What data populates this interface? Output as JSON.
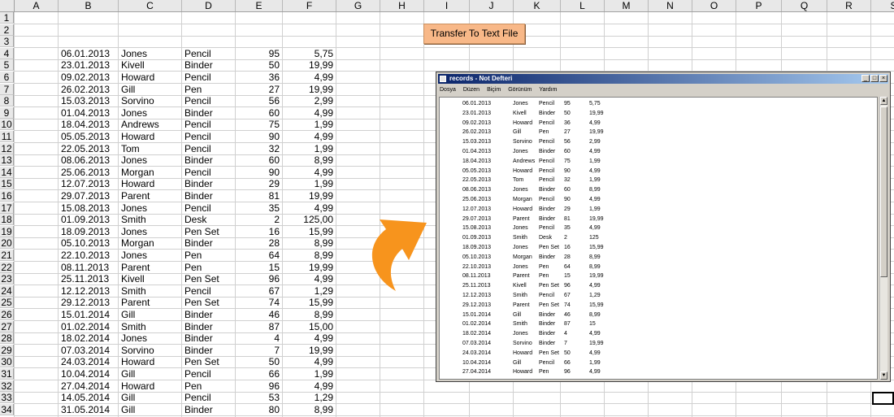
{
  "columns": [
    "A",
    "B",
    "C",
    "D",
    "E",
    "F",
    "G",
    "H",
    "I",
    "J",
    "K",
    "L",
    "M",
    "N",
    "O",
    "P",
    "Q",
    "R",
    "S"
  ],
  "row_numbers": [
    "1",
    "2",
    "3",
    "4",
    "5",
    "6",
    "7",
    "8",
    "9",
    "10",
    "11",
    "12",
    "13",
    "14",
    "15",
    "16",
    "17",
    "18",
    "19",
    "20",
    "21",
    "22",
    "23",
    "24",
    "25",
    "26",
    "27",
    "28",
    "29",
    "30",
    "31",
    "32",
    "33",
    "34"
  ],
  "records": [
    [
      "06.01.2013",
      "Jones",
      "Pencil",
      "95",
      "5,75"
    ],
    [
      "23.01.2013",
      "Kivell",
      "Binder",
      "50",
      "19,99"
    ],
    [
      "09.02.2013",
      "Howard",
      "Pencil",
      "36",
      "4,99"
    ],
    [
      "26.02.2013",
      "Gill",
      "Pen",
      "27",
      "19,99"
    ],
    [
      "15.03.2013",
      "Sorvino",
      "Pencil",
      "56",
      "2,99"
    ],
    [
      "01.04.2013",
      "Jones",
      "Binder",
      "60",
      "4,99"
    ],
    [
      "18.04.2013",
      "Andrews",
      "Pencil",
      "75",
      "1,99"
    ],
    [
      "05.05.2013",
      "Howard",
      "Pencil",
      "90",
      "4,99"
    ],
    [
      "22.05.2013",
      "Tom",
      "Pencil",
      "32",
      "1,99"
    ],
    [
      "08.06.2013",
      "Jones",
      "Binder",
      "60",
      "8,99"
    ],
    [
      "25.06.2013",
      "Morgan",
      "Pencil",
      "90",
      "4,99"
    ],
    [
      "12.07.2013",
      "Howard",
      "Binder",
      "29",
      "1,99"
    ],
    [
      "29.07.2013",
      "Parent",
      "Binder",
      "81",
      "19,99"
    ],
    [
      "15.08.2013",
      "Jones",
      "Pencil",
      "35",
      "4,99"
    ],
    [
      "01.09.2013",
      "Smith",
      "Desk",
      "2",
      "125,00"
    ],
    [
      "18.09.2013",
      "Jones",
      "Pen Set",
      "16",
      "15,99"
    ],
    [
      "05.10.2013",
      "Morgan",
      "Binder",
      "28",
      "8,99"
    ],
    [
      "22.10.2013",
      "Jones",
      "Pen",
      "64",
      "8,99"
    ],
    [
      "08.11.2013",
      "Parent",
      "Pen",
      "15",
      "19,99"
    ],
    [
      "25.11.2013",
      "Kivell",
      "Pen Set",
      "96",
      "4,99"
    ],
    [
      "12.12.2013",
      "Smith",
      "Pencil",
      "67",
      "1,29"
    ],
    [
      "29.12.2013",
      "Parent",
      "Pen Set",
      "74",
      "15,99"
    ],
    [
      "15.01.2014",
      "Gill",
      "Binder",
      "46",
      "8,99"
    ],
    [
      "01.02.2014",
      "Smith",
      "Binder",
      "87",
      "15,00"
    ],
    [
      "18.02.2014",
      "Jones",
      "Binder",
      "4",
      "4,99"
    ],
    [
      "07.03.2014",
      "Sorvino",
      "Binder",
      "7",
      "19,99"
    ],
    [
      "24.03.2014",
      "Howard",
      "Pen Set",
      "50",
      "4,99"
    ],
    [
      "10.04.2014",
      "Gill",
      "Pencil",
      "66",
      "1,99"
    ],
    [
      "27.04.2014",
      "Howard",
      "Pen",
      "96",
      "4,99"
    ],
    [
      "14.05.2014",
      "Gill",
      "Pencil",
      "53",
      "1,29"
    ],
    [
      "31.05.2014",
      "Gill",
      "Binder",
      "80",
      "8,99"
    ]
  ],
  "button_label": "Transfer To Text File",
  "notepad": {
    "title": "records - Not Defteri",
    "controls": [
      "_",
      "□",
      "×"
    ],
    "menu": [
      "Dosya",
      "Düzen",
      "Biçim",
      "Görünüm",
      "Yardım"
    ],
    "scroll_up": "▲",
    "scroll_down": "▼",
    "lines": [
      [
        "06.01.2013",
        "Jones",
        "Pencil",
        "95",
        "5,75"
      ],
      [
        "23.01.2013",
        "Kivell",
        "Binder",
        "50",
        "19,99"
      ],
      [
        "09.02.2013",
        "Howard",
        "Pencil",
        "36",
        "4,99"
      ],
      [
        "26.02.2013",
        "Gill",
        "Pen",
        "27",
        "19,99"
      ],
      [
        "15.03.2013",
        "Sorvino",
        "Pencil",
        "56",
        "2,99"
      ],
      [
        "01.04.2013",
        "Jones",
        "Binder",
        "60",
        "4,99"
      ],
      [
        "18.04.2013",
        "Andrews",
        "Pencil",
        "75",
        "1,99"
      ],
      [
        "05.05.2013",
        "Howard",
        "Pencil",
        "90",
        "4,99"
      ],
      [
        "22.05.2013",
        "Tom",
        "Pencil",
        "32",
        "1,99"
      ],
      [
        "08.06.2013",
        "Jones",
        "Binder",
        "60",
        "8,99"
      ],
      [
        "25.06.2013",
        "Morgan",
        "Pencil",
        "90",
        "4,99"
      ],
      [
        "12.07.2013",
        "Howard",
        "Binder",
        "29",
        "1,99"
      ],
      [
        "29.07.2013",
        "Parent",
        "Binder",
        "81",
        "19,99"
      ],
      [
        "15.08.2013",
        "Jones",
        "Pencil",
        "35",
        "4,99"
      ],
      [
        "01.09.2013",
        "Smith",
        "Desk",
        "2",
        "125"
      ],
      [
        "18.09.2013",
        "Jones",
        "Pen Set",
        "16",
        "15,99"
      ],
      [
        "05.10.2013",
        "Morgan",
        "Binder",
        "28",
        "8,99"
      ],
      [
        "22.10.2013",
        "Jones",
        "Pen",
        "64",
        "8,99"
      ],
      [
        "08.11.2013",
        "Parent",
        "Pen",
        "15",
        "19,99"
      ],
      [
        "25.11.2013",
        "Kivell",
        "Pen Set",
        "96",
        "4,99"
      ],
      [
        "12.12.2013",
        "Smith",
        "Pencil",
        "67",
        "1,29"
      ],
      [
        "29.12.2013",
        "Parent",
        "Pen Set",
        "74",
        "15,99"
      ],
      [
        "15.01.2014",
        "Gill",
        "Binder",
        "46",
        "8,99"
      ],
      [
        "01.02.2014",
        "Smith",
        "Binder",
        "87",
        "15"
      ],
      [
        "18.02.2014",
        "Jones",
        "Binder",
        "4",
        "4,99"
      ],
      [
        "07.03.2014",
        "Sorvino",
        "Binder",
        "7",
        "19,99"
      ],
      [
        "24.03.2014",
        "Howard",
        "Pen Set",
        "50",
        "4,99"
      ],
      [
        "10.04.2014",
        "Gill",
        "Pencil",
        "66",
        "1,99"
      ],
      [
        "27.04.2014",
        "Howard",
        "Pen",
        "96",
        "4,99"
      ]
    ]
  },
  "colors": {
    "button": "#f8b888",
    "arrow": "#f7941d",
    "titlebar": "#0a246a"
  }
}
